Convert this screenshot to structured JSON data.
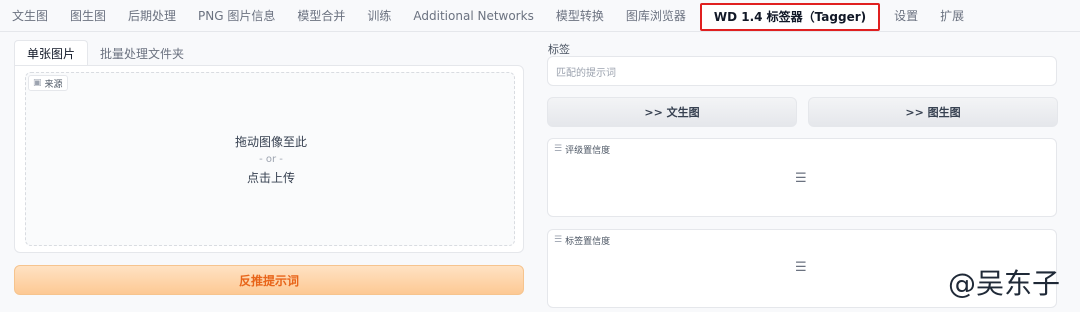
{
  "top_tabs": [
    {
      "label": "文生图"
    },
    {
      "label": "图生图"
    },
    {
      "label": "后期处理"
    },
    {
      "label": "PNG 图片信息"
    },
    {
      "label": "模型合并"
    },
    {
      "label": "训练"
    },
    {
      "label": "Additional Networks"
    },
    {
      "label": "模型转换"
    },
    {
      "label": "图库浏览器"
    },
    {
      "label": "WD 1.4 标签器（Tagger)"
    },
    {
      "label": "设置"
    },
    {
      "label": "扩展"
    }
  ],
  "active_tab_index": 9,
  "left": {
    "sub_tabs": [
      {
        "label": "单张图片"
      },
      {
        "label": "批量处理文件夹"
      }
    ],
    "source_badge": "来源",
    "drop_line1": "拖动图像至此",
    "drop_line2": "- or -",
    "drop_line3": "点击上传",
    "interrogate_label": "反推提示词"
  },
  "right": {
    "tags_label": "标签",
    "tags_placeholder": "匹配的提示词",
    "send_txt2img": ">> 文生图",
    "send_img2img": ">> 图生图",
    "rating_label": "评级置信度",
    "tag_conf_label": "标签置信度"
  },
  "watermark": "@吴东子",
  "colors": {
    "accent_orange": "#e8651a",
    "highlight_red": "#e02020"
  }
}
